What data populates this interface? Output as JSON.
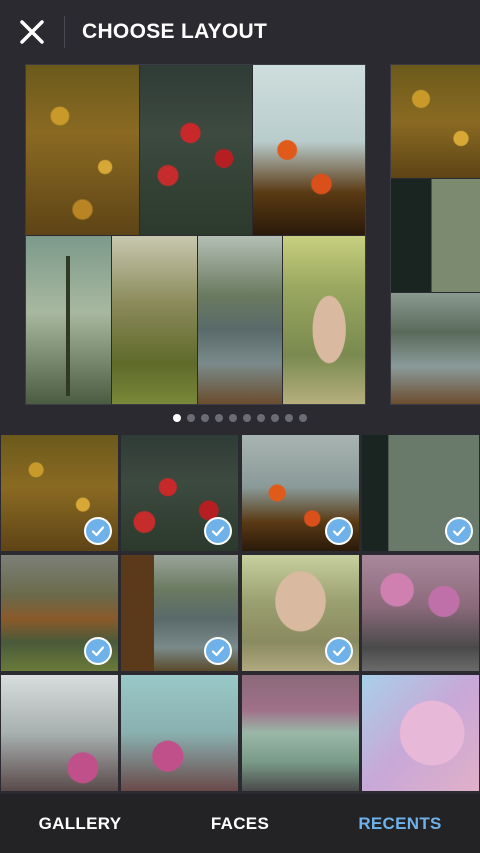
{
  "header": {
    "title": "CHOOSE LAYOUT",
    "close_icon": "close-icon"
  },
  "layout_pager": {
    "pages": 10,
    "active_page": 1
  },
  "photos": [
    {
      "selected": true
    },
    {
      "selected": true
    },
    {
      "selected": true
    },
    {
      "selected": true
    },
    {
      "selected": true
    },
    {
      "selected": true
    },
    {
      "selected": true
    },
    {
      "selected": false
    },
    {
      "selected": false
    },
    {
      "selected": false
    },
    {
      "selected": false
    },
    {
      "selected": false
    }
  ],
  "tabs": [
    {
      "label": "GALLERY",
      "active": false
    },
    {
      "label": "FACES",
      "active": false
    },
    {
      "label": "RECENTS",
      "active": true
    }
  ],
  "colors": {
    "background": "#2a2a30",
    "accent": "#6fb2ea",
    "text": "#ffffff",
    "dot_inactive": "#6c6c74"
  }
}
